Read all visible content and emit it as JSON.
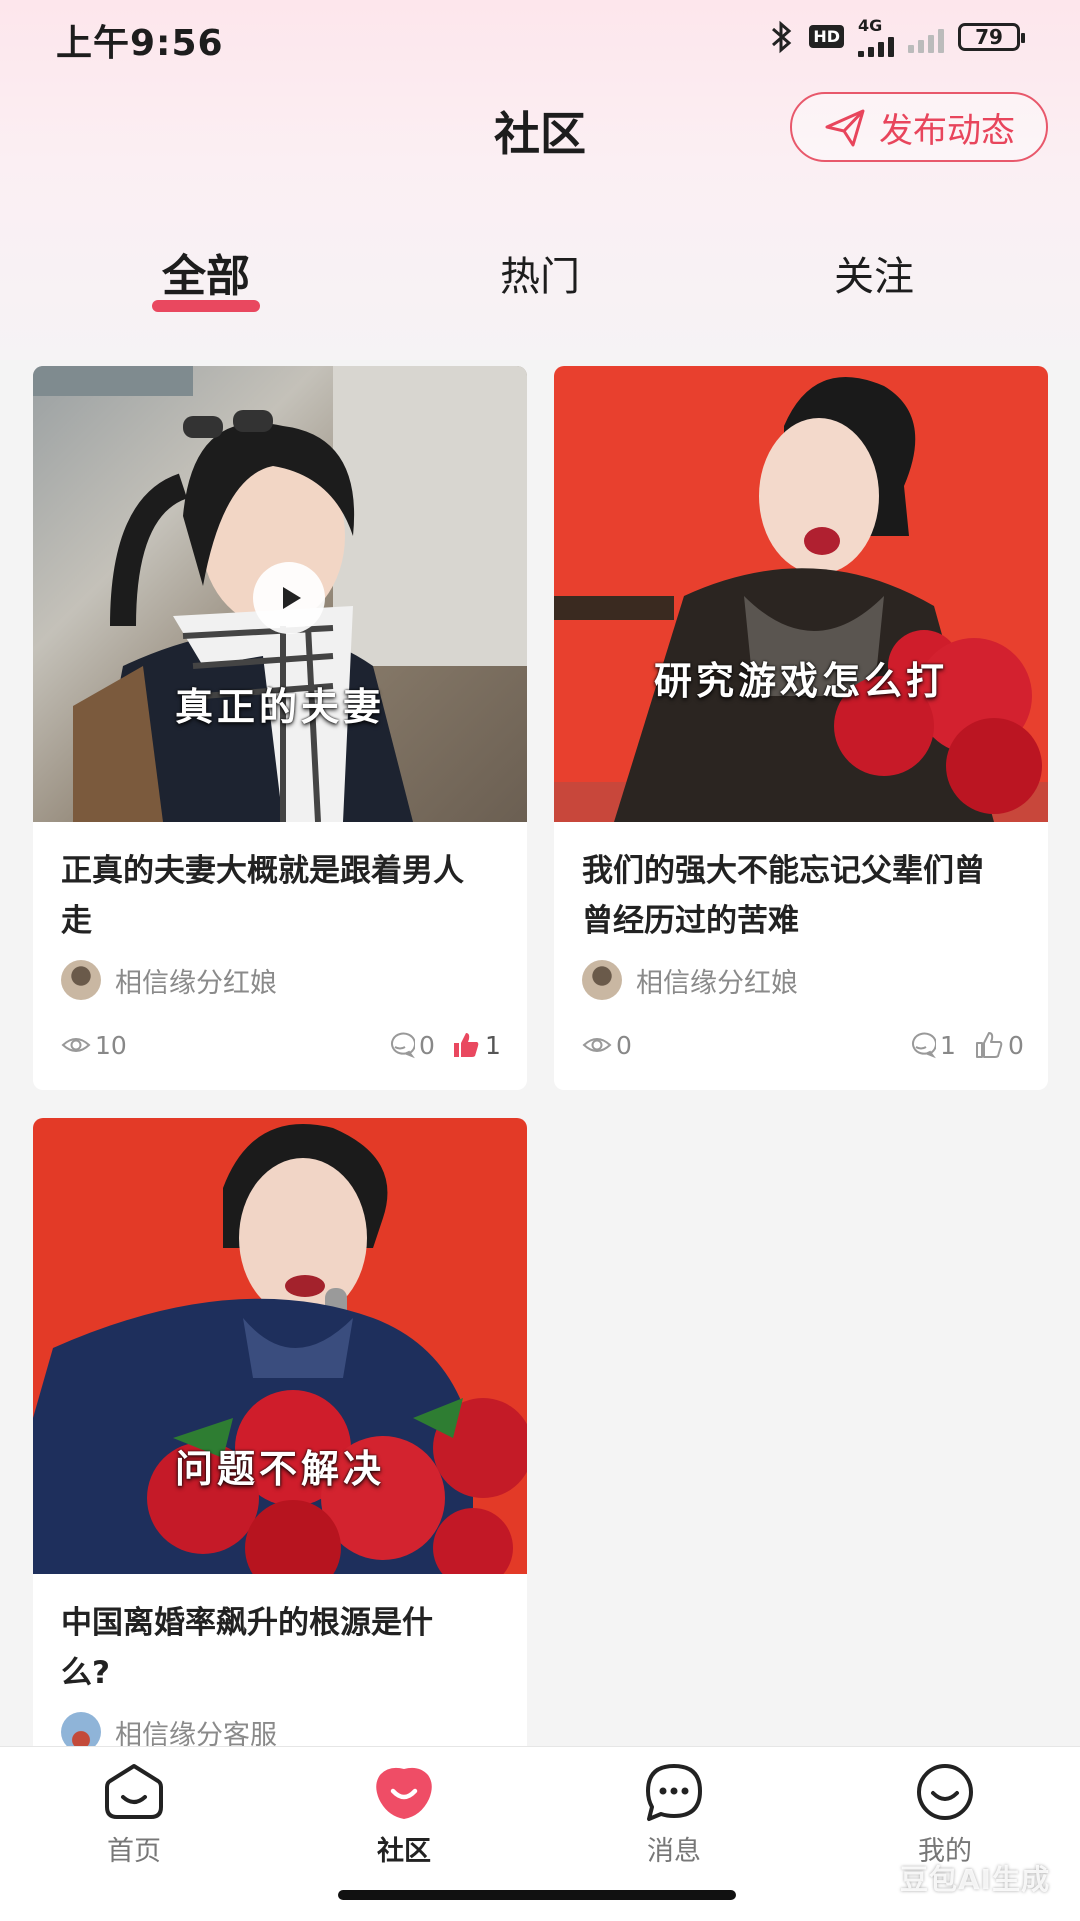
{
  "status": {
    "time": "上午9:56",
    "hd": "HD",
    "network": "4G",
    "battery": "79"
  },
  "header": {
    "title": "社区",
    "publish_label": "发布动态"
  },
  "tabs": [
    {
      "label": "全部",
      "active": true
    },
    {
      "label": "热门",
      "active": false
    },
    {
      "label": "关注",
      "active": false
    }
  ],
  "posts": [
    {
      "overlay": "真正的夫妻",
      "title_line1": "正真的夫妻大概就是跟着男人",
      "title_line2": "走",
      "author": "相信缘分红娘",
      "views": "10",
      "comments": "0",
      "likes": "1",
      "liked": true,
      "video": true
    },
    {
      "overlay": "研究游戏怎么打",
      "title_line1": "我们的强大不能忘记父辈们曾",
      "title_line2": "曾经历过的苦难",
      "author": "相信缘分红娘",
      "views": "0",
      "comments": "1",
      "likes": "0",
      "liked": false,
      "video": false
    },
    {
      "overlay": "问题不解决",
      "title_line1": "中国离婚率飙升的根源是什",
      "title_line2": "么?",
      "author": "相信缘分客服"
    }
  ],
  "nav": [
    {
      "label": "首页",
      "icon": "home-face-icon",
      "active": false
    },
    {
      "label": "社区",
      "icon": "community-icon",
      "active": true
    },
    {
      "label": "消息",
      "icon": "message-icon",
      "active": false
    },
    {
      "label": "我的",
      "icon": "profile-icon",
      "active": false
    }
  ],
  "watermark": "豆包AI生成",
  "colors": {
    "accent": "#e9485f",
    "background": "#f4f4f4"
  }
}
